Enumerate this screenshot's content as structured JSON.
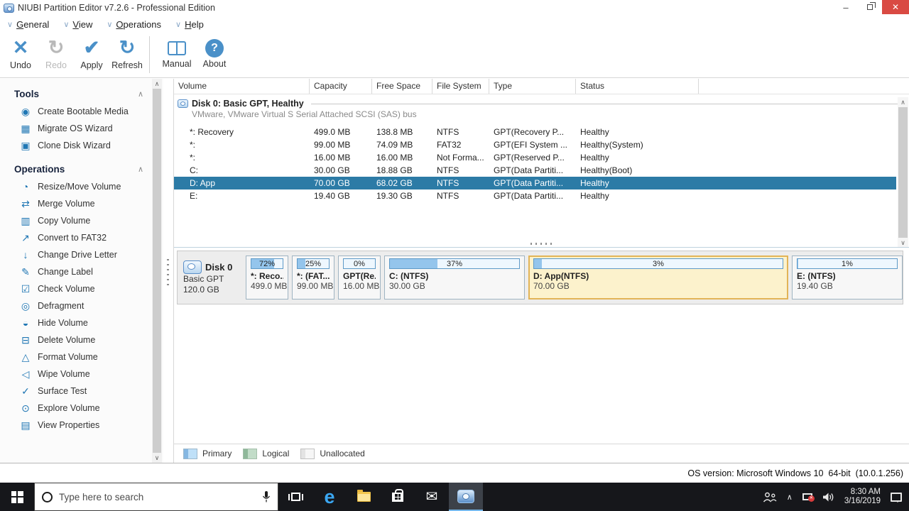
{
  "window": {
    "title": "NIUBI Partition Editor v7.2.6 - Professional Edition",
    "minimize_glyph": "–",
    "close_glyph": "✕"
  },
  "menu": {
    "items": [
      {
        "label": "General"
      },
      {
        "label": "View"
      },
      {
        "label": "Operations"
      },
      {
        "label": "Help"
      }
    ]
  },
  "toolbar": {
    "buttons": [
      {
        "label": "Undo",
        "enabled": true
      },
      {
        "label": "Redo",
        "enabled": false
      },
      {
        "label": "Apply",
        "enabled": true
      },
      {
        "label": "Refresh",
        "enabled": true
      },
      {
        "label": "Manual",
        "enabled": true
      },
      {
        "label": "About",
        "enabled": true
      }
    ],
    "about_glyph": "?"
  },
  "glyphs": {
    "chevron_down": "∨",
    "chevron_up": "∧",
    "undo": "✕",
    "redo": "↻",
    "apply": "✔",
    "refresh": "↻",
    "cd": "◉",
    "migrate": "▦",
    "clone": "▣",
    "resize": "◔",
    "merge": "⇄",
    "copy": "▥",
    "convert": "↗",
    "drive_letter": "↓",
    "label": "✎",
    "check": "☑",
    "defrag": "◎",
    "hide": "◒",
    "delete": "⊟",
    "format": "△",
    "wipe": "◁",
    "surface": "✓",
    "explore": "⊙",
    "properties": "▤"
  },
  "sidebar": {
    "tools": {
      "header": "Tools",
      "items": [
        {
          "icon": "cd-icon",
          "label": "Create Bootable Media"
        },
        {
          "icon": "migrate-icon",
          "label": "Migrate OS Wizard"
        },
        {
          "icon": "clone-icon",
          "label": "Clone Disk Wizard"
        }
      ]
    },
    "operations": {
      "header": "Operations",
      "items": [
        {
          "icon": "resize-icon",
          "label": "Resize/Move Volume"
        },
        {
          "icon": "merge-icon",
          "label": "Merge Volume"
        },
        {
          "icon": "copy-icon",
          "label": "Copy Volume"
        },
        {
          "icon": "convert-icon",
          "label": "Convert to FAT32"
        },
        {
          "icon": "drive-letter-icon",
          "label": "Change Drive Letter"
        },
        {
          "icon": "label-icon",
          "label": "Change Label"
        },
        {
          "icon": "check-icon",
          "label": "Check Volume"
        },
        {
          "icon": "defrag-icon",
          "label": "Defragment"
        },
        {
          "icon": "hide-icon",
          "label": "Hide Volume"
        },
        {
          "icon": "delete-icon",
          "label": "Delete Volume"
        },
        {
          "icon": "format-icon",
          "label": "Format Volume"
        },
        {
          "icon": "wipe-icon",
          "label": "Wipe Volume"
        },
        {
          "icon": "surface-icon",
          "label": "Surface Test"
        },
        {
          "icon": "explore-icon",
          "label": "Explore Volume"
        },
        {
          "icon": "properties-icon",
          "label": "View Properties"
        }
      ]
    }
  },
  "table": {
    "columns": [
      "Volume",
      "Capacity",
      "Free Space",
      "File System",
      "Type",
      "Status"
    ],
    "disk_group": {
      "title": "Disk 0: Basic GPT, Healthy",
      "subtitle": "VMware, VMware Virtual S Serial Attached SCSI (SAS) bus"
    },
    "rows": [
      {
        "volume": "*: Recovery",
        "capacity": "499.0 MB",
        "free": "138.8 MB",
        "fs": "NTFS",
        "type": "GPT(Recovery P...",
        "status": "Healthy",
        "selected": false
      },
      {
        "volume": "*:",
        "capacity": "99.00 MB",
        "free": "74.09 MB",
        "fs": "FAT32",
        "type": "GPT(EFI System ...",
        "status": "Healthy(System)",
        "selected": false
      },
      {
        "volume": "*:",
        "capacity": "16.00 MB",
        "free": "16.00 MB",
        "fs": "Not Forma...",
        "type": "GPT(Reserved P...",
        "status": "Healthy",
        "selected": false
      },
      {
        "volume": "C:",
        "capacity": "30.00 GB",
        "free": "18.88 GB",
        "fs": "NTFS",
        "type": "GPT(Data Partiti...",
        "status": "Healthy(Boot)",
        "selected": false
      },
      {
        "volume": "D: App",
        "capacity": "70.00 GB",
        "free": "68.02 GB",
        "fs": "NTFS",
        "type": "GPT(Data Partiti...",
        "status": "Healthy",
        "selected": true
      },
      {
        "volume": "E:",
        "capacity": "19.40 GB",
        "free": "19.30 GB",
        "fs": "NTFS",
        "type": "GPT(Data Partiti...",
        "status": "Healthy",
        "selected": false
      }
    ]
  },
  "disk_map": {
    "disk": {
      "name": "Disk 0",
      "type": "Basic GPT",
      "size": "120.0 GB"
    },
    "blocks": [
      {
        "percent": "72%",
        "usage": 72,
        "label": "*: Reco...",
        "size": "499.0 MB",
        "selected": false
      },
      {
        "percent": "25%",
        "usage": 25,
        "label": "*: (FAT...",
        "size": "99.00 MB",
        "selected": false
      },
      {
        "percent": "0%",
        "usage": 0,
        "label": "GPT(Re...",
        "size": "16.00 MB",
        "selected": false
      },
      {
        "percent": "37%",
        "usage": 37,
        "label": "C: (NTFS)",
        "size": "30.00 GB",
        "selected": false
      },
      {
        "percent": "3%",
        "usage": 3,
        "label": "D: App(NTFS)",
        "size": "70.00 GB",
        "selected": true
      },
      {
        "percent": "1%",
        "usage": 1,
        "label": "E: (NTFS)",
        "size": "19.40 GB",
        "selected": false
      }
    ]
  },
  "legend": {
    "items": [
      {
        "label": "Primary"
      },
      {
        "label": "Logical"
      },
      {
        "label": "Unallocated"
      }
    ]
  },
  "statusbar": {
    "os_version": "OS version: Microsoft Windows 10  64-bit  (10.0.1.256)"
  },
  "taskbar": {
    "search_placeholder": "Type here to search",
    "time": "8:30 AM",
    "date": "3/16/2019"
  },
  "colors": {
    "accent_blue": "#4a90c8",
    "selection_blue": "#2c7ba6",
    "selected_block_bg": "#fcf2cc",
    "selected_block_border": "#e2b457",
    "usage_fill": "#94c5ec",
    "close_red": "#d94a43",
    "legend_primary": "#bfe0f8",
    "legend_logical": "#c2dcc8"
  }
}
